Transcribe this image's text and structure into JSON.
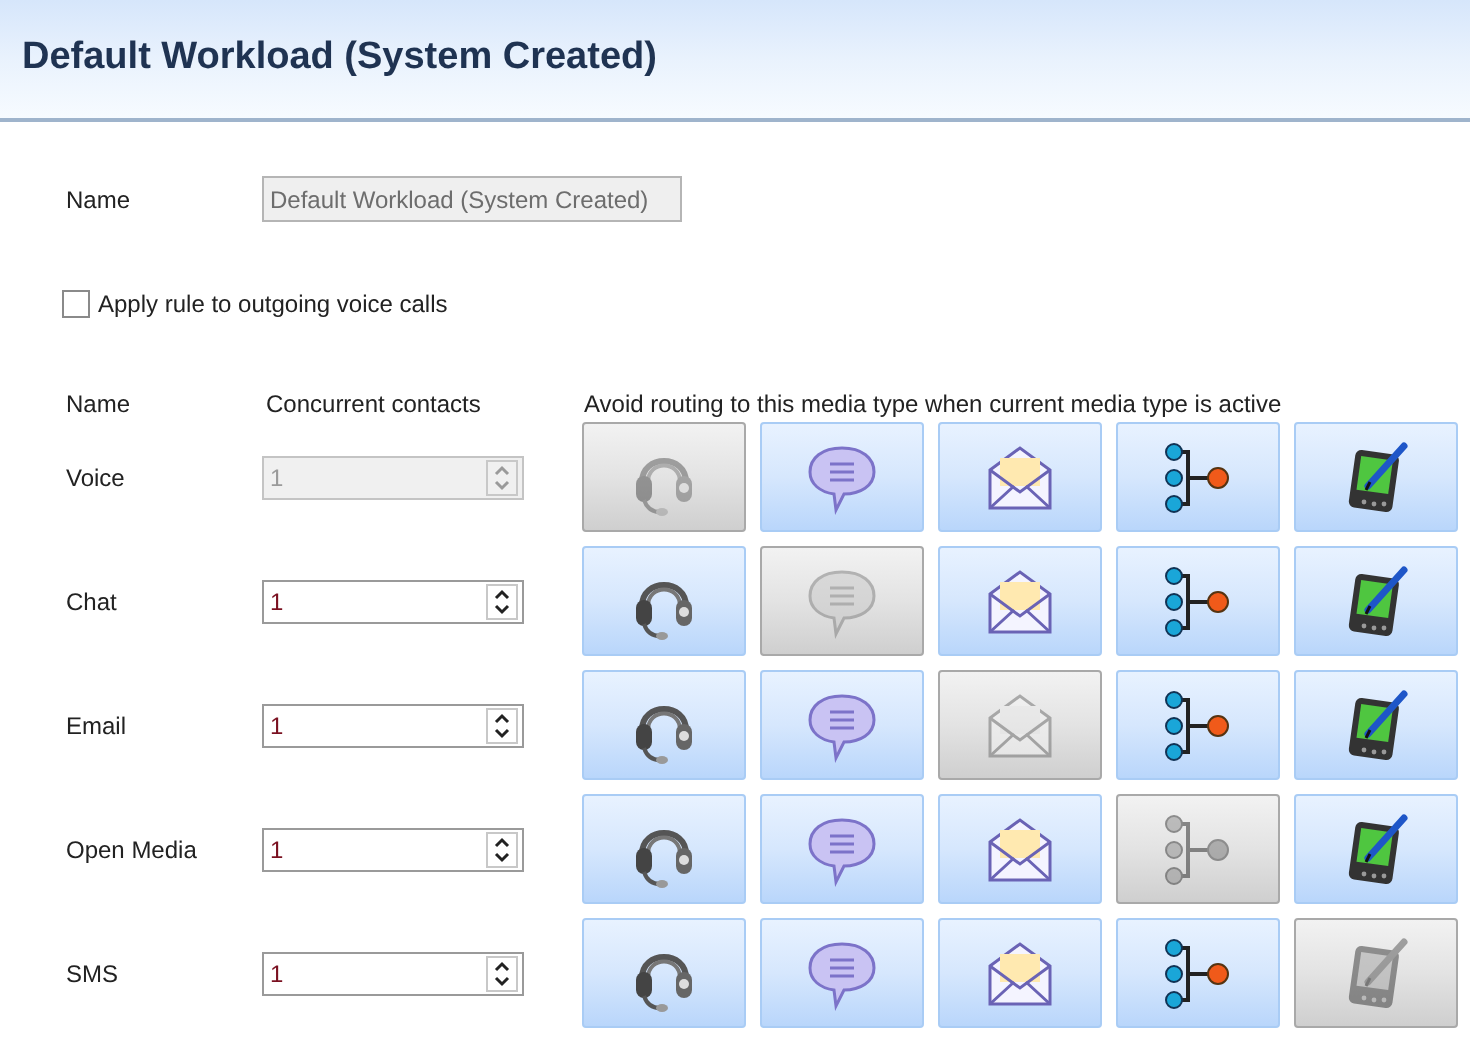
{
  "window": {
    "title": "Default Workload (System Created)"
  },
  "name_field": {
    "label": "Name",
    "value": "Default Workload (System Created)",
    "disabled": true
  },
  "apply_outgoing": {
    "label": "Apply rule to outgoing voice calls",
    "checked": false
  },
  "columns": [
    "Name",
    "Concurrent contacts",
    "Avoid routing to this media type when current media type is active"
  ],
  "rows": [
    {
      "name": "Voice",
      "contacts": "1",
      "disabled": true,
      "avoid": [
        {
          "kind": "voice",
          "disabled": true
        },
        {
          "kind": "chat",
          "disabled": false
        },
        {
          "kind": "email",
          "disabled": false
        },
        {
          "kind": "openmedia",
          "disabled": false
        },
        {
          "kind": "sms",
          "disabled": false
        }
      ]
    },
    {
      "name": "Chat",
      "contacts": "1",
      "disabled": false,
      "avoid": [
        {
          "kind": "voice",
          "disabled": false
        },
        {
          "kind": "chat",
          "disabled": true
        },
        {
          "kind": "email",
          "disabled": false
        },
        {
          "kind": "openmedia",
          "disabled": false
        },
        {
          "kind": "sms",
          "disabled": false
        }
      ]
    },
    {
      "name": "Email",
      "contacts": "1",
      "disabled": false,
      "avoid": [
        {
          "kind": "voice",
          "disabled": false
        },
        {
          "kind": "chat",
          "disabled": false
        },
        {
          "kind": "email",
          "disabled": true
        },
        {
          "kind": "openmedia",
          "disabled": false
        },
        {
          "kind": "sms",
          "disabled": false
        }
      ]
    },
    {
      "name": "Open Media",
      "contacts": "1",
      "disabled": false,
      "avoid": [
        {
          "kind": "voice",
          "disabled": false
        },
        {
          "kind": "chat",
          "disabled": false
        },
        {
          "kind": "email",
          "disabled": false
        },
        {
          "kind": "openmedia",
          "disabled": true
        },
        {
          "kind": "sms",
          "disabled": false
        }
      ]
    },
    {
      "name": "SMS",
      "contacts": "1",
      "disabled": false,
      "avoid": [
        {
          "kind": "voice",
          "disabled": false
        },
        {
          "kind": "chat",
          "disabled": false
        },
        {
          "kind": "email",
          "disabled": false
        },
        {
          "kind": "openmedia",
          "disabled": false
        },
        {
          "kind": "sms",
          "disabled": true
        }
      ]
    }
  ]
}
